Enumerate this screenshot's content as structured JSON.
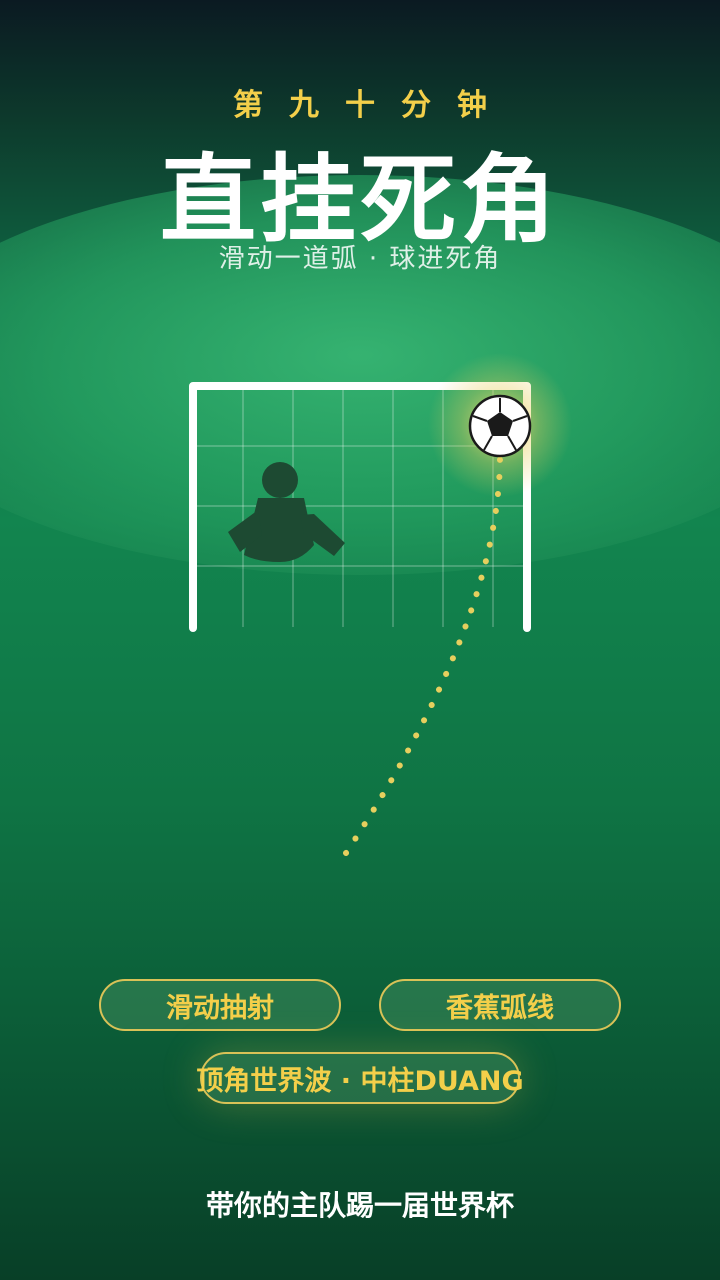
{
  "header": {
    "eyebrow": "第九十分钟",
    "title": "直挂死角",
    "subtitle": "滑动一道弧 · 球进死角"
  },
  "scene": {
    "goal": "goal-frame",
    "keeper": "goalkeeper-silhouette",
    "ball": "soccer-ball-icon",
    "trajectory": "dotted-shot-path"
  },
  "options": [
    {
      "label": "滑动抽射"
    },
    {
      "label": "香蕉弧线"
    },
    {
      "label": "顶角世界波 · 中柱DUANG"
    }
  ],
  "footer": {
    "tagline": "带你的主队踢一届世界杯"
  },
  "colors": {
    "accent_gold": "#f3cf4a",
    "pitch_green": "#12854f",
    "net_white": "#ffffff"
  }
}
